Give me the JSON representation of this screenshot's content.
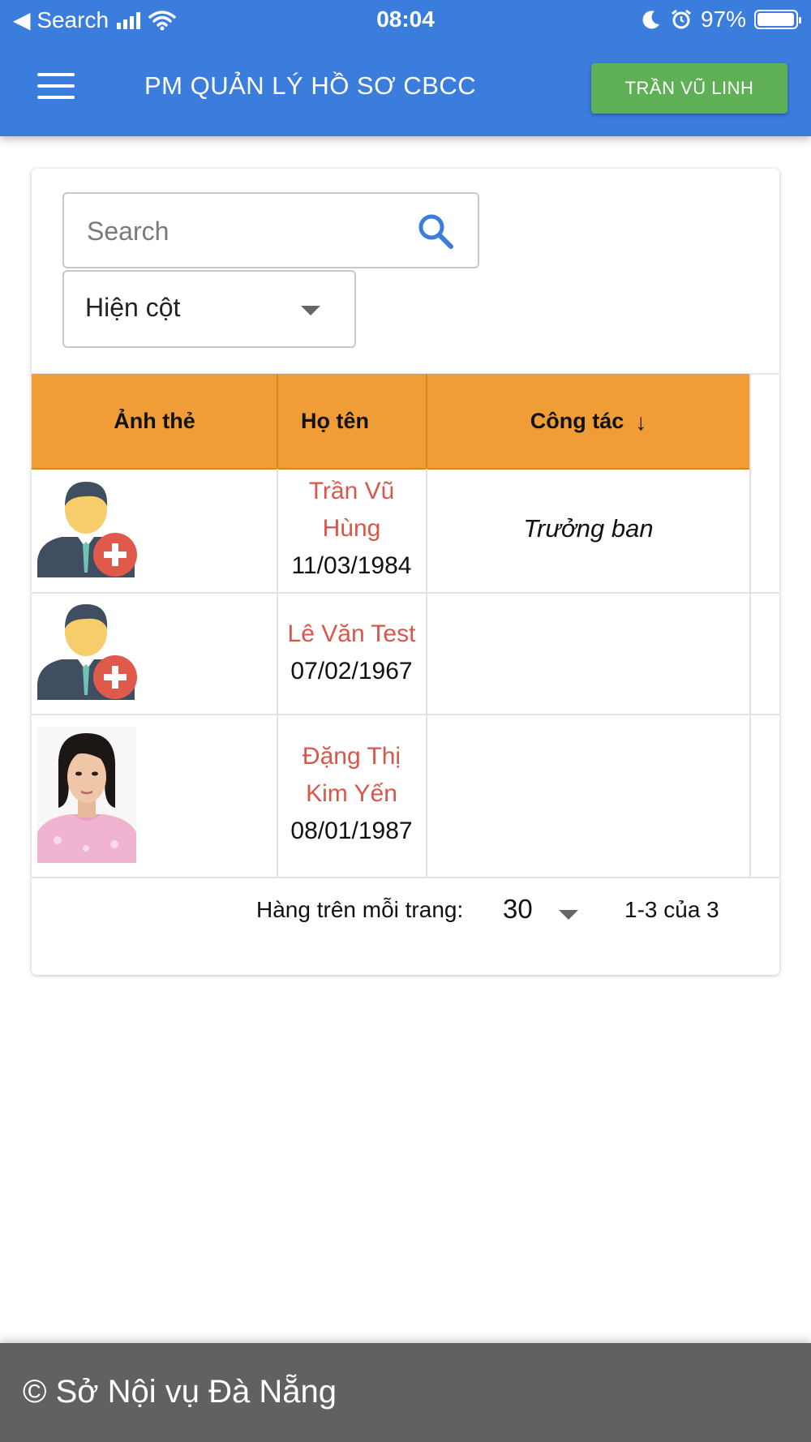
{
  "status_bar": {
    "back_label": "◀ Search",
    "time": "08:04",
    "battery": "97%",
    "battery_level": 0.97
  },
  "header": {
    "title": "PM QUẢN LÝ HỒ SƠ CBCC",
    "user_button": "TRẦN VŨ LINH"
  },
  "search": {
    "placeholder": "Search",
    "value": ""
  },
  "column_select": {
    "label": "Hiện cột"
  },
  "table": {
    "headers": [
      "Ảnh thẻ",
      "Họ tên",
      "Công tác"
    ],
    "sort_indicator": "↓",
    "rows": [
      {
        "name_line1": "Trần Vũ",
        "name_line2": "Hùng",
        "dob": "11/03/1984",
        "work": "Trưởng ban",
        "photo": "default-avatar-icon"
      },
      {
        "name_line1": "Lê Văn Test",
        "dob": "07/02/1967",
        "work": "",
        "photo": "default-avatar-icon"
      },
      {
        "name_line1": "Đặng Thị",
        "name_line2": "Kim Yến",
        "dob": "08/01/1987",
        "work": "",
        "photo": "portrait-photo"
      }
    ]
  },
  "pagination": {
    "rows_per_page_label": "Hàng trên mỗi trang:",
    "rows_per_page": "30",
    "range": "1-3 của 3"
  },
  "footer": {
    "text": "© Sở Nội vụ Đà Nẵng"
  },
  "colors": {
    "app_bar": "#3b7ddd",
    "user_button": "#5faf56",
    "table_header": "#f09d38",
    "name_text": "#d9574a",
    "footer": "#616161"
  }
}
